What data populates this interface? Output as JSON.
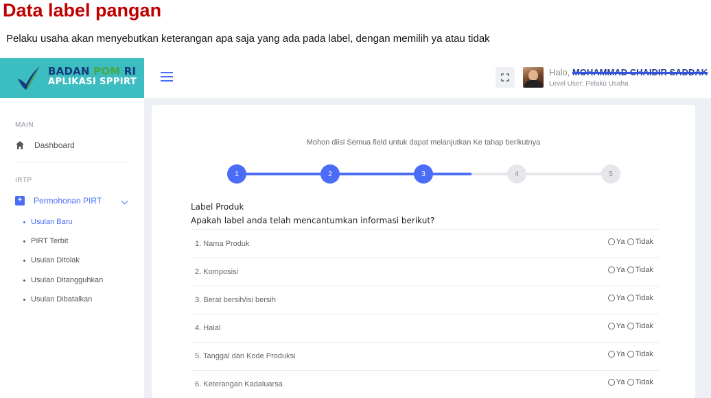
{
  "doc": {
    "title": "Data label pangan",
    "subtitle": "Pelaku usaha akan menyebutkan keterangan apa saja yang ada pada label, dengan memilih ya atau tidak"
  },
  "brand": {
    "line1_a": "BADAN ",
    "line1_b": "POM",
    "line1_c": " RI",
    "line2": "APLIKASI SPPIRT"
  },
  "header": {
    "greeting": "Halo, ",
    "user_name": "MOHAMMAD CHAIDIR SADDAK",
    "user_level": "Level User: Pelaku Usaha",
    "fullscreen_icon": "fullscreen-icon",
    "menu_icon": "hamburger-icon"
  },
  "sidebar": {
    "main_title": "MAIN",
    "dashboard": "Dashboard",
    "irtp_title": "IRTP",
    "permohonan": "Permohonan PIRT",
    "subitems": [
      "Usulan Baru",
      "PIRT Terbit",
      "Usulan Ditolak",
      "Usulan Ditangguhkan",
      "Usulan Dibatalkan"
    ],
    "active_subitem": "Usulan Baru"
  },
  "form": {
    "notice": "Mohon diisi Semua field untuk dapat melanjutkan Ke tahap berikutnya",
    "steps": [
      "1",
      "2",
      "3",
      "4",
      "5"
    ],
    "current_step": 3,
    "section_title": "Label Produk",
    "question": "Apakah label anda telah mencantumkan informasi berikut?",
    "option_yes": "Ya",
    "option_no": "Tidak",
    "items": [
      "1. Nama Produk",
      "2. Komposisi",
      "3. Berat bersih/isi bersih",
      "4. Halal",
      "5. Tanggal dan Kode Produksi",
      "6. Keterangan Kadaluarsa"
    ]
  },
  "colors": {
    "accent": "#4a6cf7",
    "brand": "#3bbdc1",
    "title_red": "#c00000"
  }
}
